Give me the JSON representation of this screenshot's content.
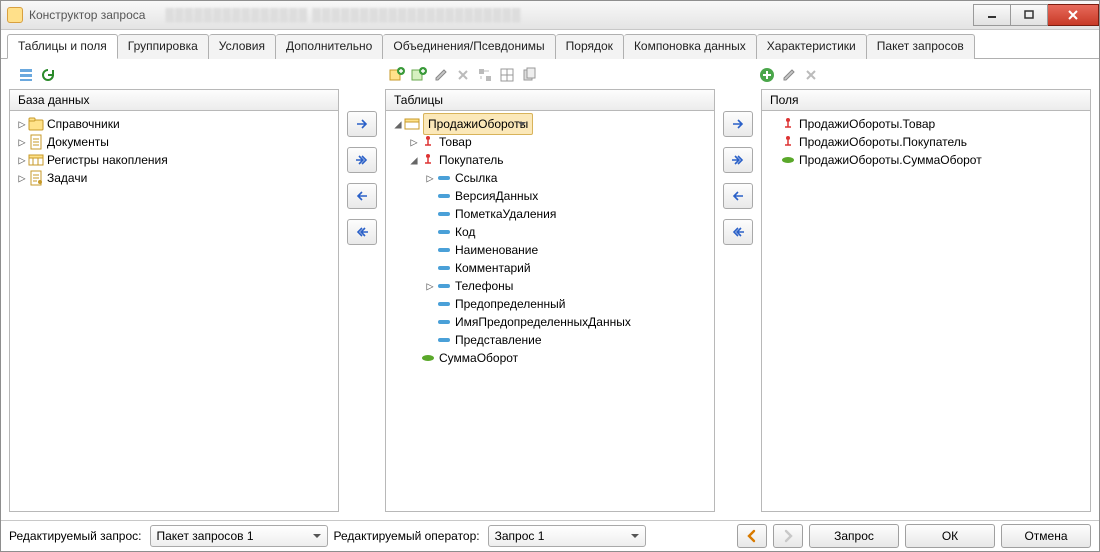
{
  "window": {
    "title": "Конструктор запроса"
  },
  "tabs": [
    "Таблицы и поля",
    "Группировка",
    "Условия",
    "Дополнительно",
    "Объединения/Псевдонимы",
    "Порядок",
    "Компоновка данных",
    "Характеристики",
    "Пакет запросов"
  ],
  "panes": {
    "database": "База данных",
    "tables": "Таблицы",
    "fields": "Поля"
  },
  "db": [
    "Справочники",
    "Документы",
    "Регистры накопления",
    "Задачи"
  ],
  "tables": {
    "root": "ПродажиОбороты",
    "fields": [
      "Товар",
      "Покупатель",
      "СуммаОборот"
    ],
    "sub": [
      "Ссылка",
      "ВерсияДанных",
      "ПометкаУдаления",
      "Код",
      "Наименование",
      "Комментарий",
      "Телефоны",
      "Предопределенный",
      "ИмяПредопределенныхДанных",
      "Представление"
    ]
  },
  "fields": [
    "ПродажиОбороты.Товар",
    "ПродажиОбороты.Покупатель",
    "ПродажиОбороты.СуммаОборот"
  ],
  "footer": {
    "query_label": "Редактируемый запрос:",
    "query_value": "Пакет запросов 1",
    "operator_label": "Редактируемый оператор:",
    "operator_value": "Запрос 1",
    "buttons": [
      "Запрос",
      "ОК",
      "Отмена"
    ]
  }
}
